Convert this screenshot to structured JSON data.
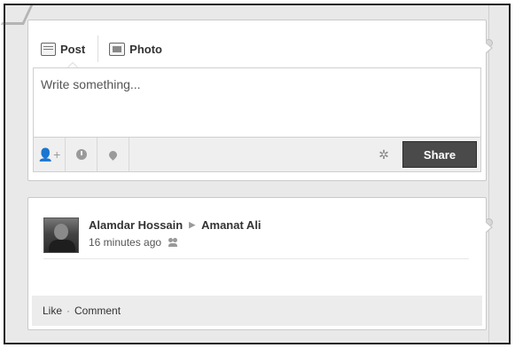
{
  "composer": {
    "tabs": [
      {
        "label": "Post",
        "icon": "speech-bubble-icon"
      },
      {
        "label": "Photo",
        "icon": "photo-icon"
      }
    ],
    "placeholder": "Write something...",
    "toolbar_icons": [
      "tag-people-icon",
      "clock-icon",
      "location-pin-icon",
      "settings-gear-icon"
    ],
    "share_label": "Share"
  },
  "story": {
    "author": "Alamdar Hossain",
    "recipient": "Amanat Ali",
    "time": "16 minutes ago",
    "audience_icon": "friends-icon",
    "actions": {
      "like": "Like",
      "separator": "·",
      "comment": "Comment"
    }
  }
}
